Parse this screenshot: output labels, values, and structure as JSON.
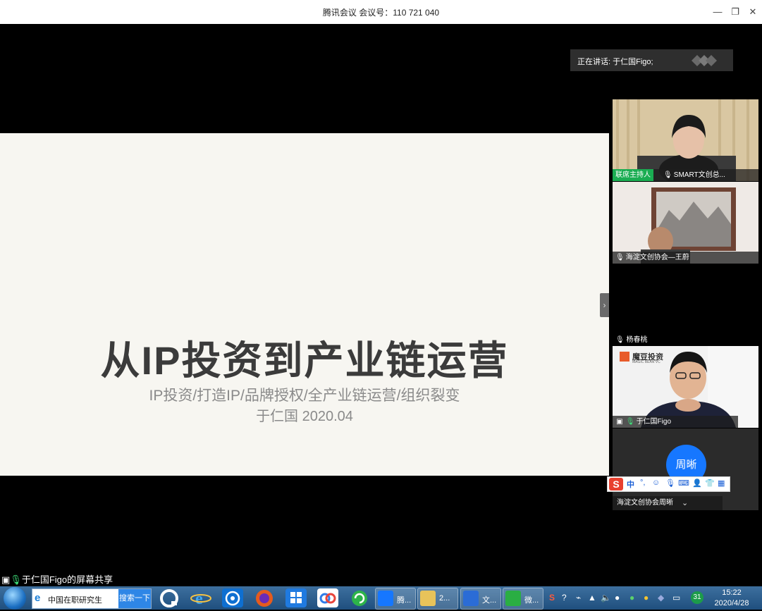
{
  "window": {
    "title": "腾讯会议 会议号：110 721 040",
    "minimize_glyph": "—",
    "restore_glyph": "❐",
    "close_glyph": "✕"
  },
  "speaking": {
    "label": "正在讲话: 于仁国Figo;"
  },
  "slide": {
    "title": "从IP投资到产业链运营",
    "subtitle": "IP投资/打造IP/品牌授权/全产业链运营/组织裂变",
    "author": "于仁国 2020.04"
  },
  "participants": [
    {
      "badge": "联席主持人",
      "name": "SMART文创总..."
    },
    {
      "name": "海淀文创协会—王蔚"
    },
    {
      "name": "杨春桃"
    },
    {
      "name": "于仁国Figo",
      "overlay_brand": "魔豆投资",
      "overlay_sub": "MAGIC BEAN VC"
    },
    {
      "name": "海淀文创协会周晰",
      "avatar_text": "周晰"
    }
  ],
  "ime": {
    "logo": "S",
    "mode": "中",
    "punct": "°,"
  },
  "share_label": "于仁国Figo的屏幕共享",
  "taskbar": {
    "search_text": "中国在职研究生",
    "search_button": "搜索一下",
    "windows": [
      {
        "label": "腾..."
      },
      {
        "label": "2..."
      },
      {
        "label": "文..."
      },
      {
        "label": "微..."
      }
    ],
    "badge_31": "31",
    "time": "15:22",
    "date": "2020/4/28"
  },
  "colors": {
    "host_badge": "#1aad52",
    "avatar_blue": "#1677ff",
    "taskbar": "#2a5d8f"
  }
}
